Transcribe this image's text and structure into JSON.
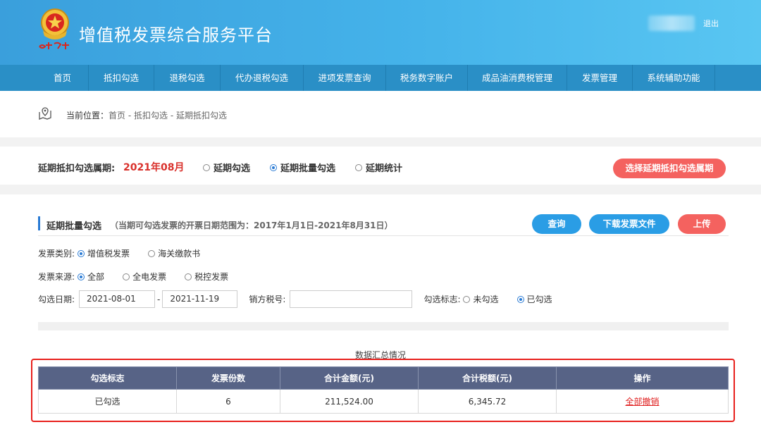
{
  "header": {
    "title": "增值税发票综合服务平台",
    "logo_text": "中国税务",
    "logout": "退出"
  },
  "nav": [
    {
      "label": "首页"
    },
    {
      "label": "抵扣勾选"
    },
    {
      "label": "退税勾选"
    },
    {
      "label": "代办退税勾选"
    },
    {
      "label": "进项发票查询"
    },
    {
      "label": "税务数字账户"
    },
    {
      "label": "成品油消费税管理"
    },
    {
      "label": "发票管理"
    },
    {
      "label": "系统辅助功能"
    }
  ],
  "breadcrumb": {
    "prefix": "当前位置：",
    "items": [
      "首页",
      "抵扣勾选",
      "延期抵扣勾选"
    ],
    "separator": " - "
  },
  "period": {
    "label": "延期抵扣勾选属期:",
    "value": "2021年08月",
    "modes": [
      {
        "label": "延期勾选",
        "checked": false
      },
      {
        "label": "延期批量勾选",
        "checked": true
      },
      {
        "label": "延期统计",
        "checked": false
      }
    ],
    "select_button": "选择延期抵扣勾选属期"
  },
  "section": {
    "title": "延期批量勾选",
    "note": "（当期可勾选发票的开票日期范围为：2017年1月1日-2021年8月31日）",
    "buttons": {
      "query": "查询",
      "download": "下载发票文件",
      "upload": "上传"
    }
  },
  "form": {
    "invoice_type": {
      "label": "发票类别:",
      "options": [
        {
          "label": "增值税发票",
          "checked": true
        },
        {
          "label": "海关缴款书",
          "checked": false
        }
      ]
    },
    "invoice_source": {
      "label": "发票来源:",
      "options": [
        {
          "label": "全部",
          "checked": true
        },
        {
          "label": "全电发票",
          "checked": false
        },
        {
          "label": "税控发票",
          "checked": false
        }
      ]
    },
    "date": {
      "label": "勾选日期:",
      "start": "2021-08-01",
      "dash": "-",
      "end": "2021-11-19"
    },
    "seller_tax": {
      "label": "销方税号:",
      "value": ""
    },
    "check_flag": {
      "label": "勾选标志:",
      "options": [
        {
          "label": "未勾选",
          "checked": false
        },
        {
          "label": "已勾选",
          "checked": true
        }
      ]
    }
  },
  "summary": {
    "title": "数据汇总情况",
    "columns": [
      "勾选标志",
      "发票份数",
      "合计金额(元)",
      "合计税额(元)",
      "操作"
    ],
    "rows": [
      {
        "flag": "已勾选",
        "count": "6",
        "amount": "211,524.00",
        "tax": "6,345.72",
        "action": "全部撤销"
      }
    ]
  },
  "colors": {
    "header_gradient_start": "#3a9fdc",
    "nav": "#2a8fc6",
    "accent_red": "#f4625f",
    "accent_blue": "#2a9de5",
    "table_header": "#576386",
    "highlight_frame": "#e8201c"
  }
}
